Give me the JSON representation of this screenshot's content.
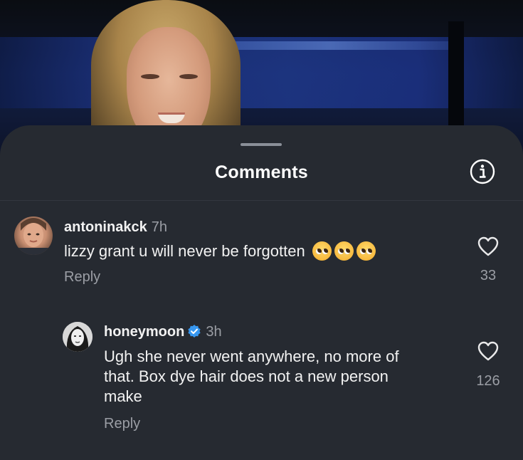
{
  "sheet": {
    "title": "Comments"
  },
  "comments": [
    {
      "username": "antoninakck",
      "time": "7h",
      "text": "lizzy grant u will never be forgotten",
      "emojis": [
        "pleading-face",
        "pleading-face",
        "pleading-face"
      ],
      "reply_label": "Reply",
      "likes": "33"
    },
    {
      "username": "honeymoon",
      "verified": true,
      "time": "3h",
      "text_lines": [
        "Ugh she never went anywhere, no more of",
        "that. Box dye hair does not a new person",
        "make"
      ],
      "reply_label": "Reply",
      "likes": "126"
    }
  ],
  "icons": {
    "info": "info-icon",
    "like": "heart-icon",
    "verified": "verified-badge-icon"
  },
  "colors": {
    "sheet_bg": "#262a31",
    "muted_text": "#9b9ea5",
    "verified_blue": "#3797f0"
  }
}
